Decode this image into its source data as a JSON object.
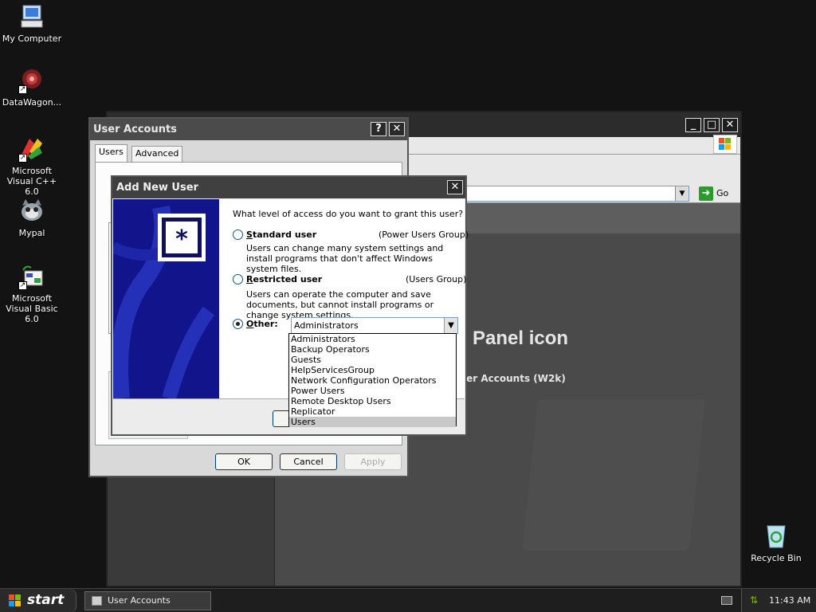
{
  "desktop": {
    "icons": [
      {
        "label": "My Computer",
        "icon": "computer-icon"
      },
      {
        "label": "DataWagon...",
        "icon": "datawagon-icon"
      },
      {
        "label": "Microsoft Visual C++ 6.0",
        "icon": "visual-cpp-icon"
      },
      {
        "label": "Mypal",
        "icon": "mypal-icon"
      },
      {
        "label": "Microsoft Visual Basic 6.0",
        "icon": "visual-basic-icon"
      },
      {
        "label": "Recycle Bin",
        "icon": "recycle-bin-icon"
      }
    ]
  },
  "background_window": {
    "address_go": "Go",
    "heading": "Panel icon",
    "subtext": "ser Accounts (W2k)"
  },
  "user_accounts": {
    "title": "User Accounts",
    "tabs": [
      {
        "label": "Users"
      },
      {
        "label": "Advanced"
      }
    ],
    "ok_label": "OK",
    "cancel_label": "Cancel",
    "apply_label": "Apply"
  },
  "add_new_user": {
    "title": "Add New User",
    "question": "What level of access do you want to grant this user?",
    "standard": {
      "label_hot": "S",
      "label_rest": "tandard user",
      "group": "(Power Users Group)",
      "desc": "Users can change many system settings and install programs that don't affect Windows system files."
    },
    "restricted": {
      "label_hot": "R",
      "label_rest": "estricted user",
      "group": "(Users Group)",
      "desc": "Users can operate the computer and save documents, but cannot install programs or change system settings."
    },
    "other": {
      "label_hot": "O",
      "label_rest": "ther:",
      "selected_value": "Administrators",
      "options": [
        "Administrators",
        "Backup Operators",
        "Guests",
        "HelpServicesGroup",
        "Network Configuration Operators",
        "Power Users",
        "Remote Desktop Users",
        "Replicator",
        "Users"
      ],
      "highlighted_index": 8
    }
  },
  "taskbar": {
    "start_label": "start",
    "tasks": [
      {
        "label": "User Accounts"
      }
    ],
    "clock": "11:43 AM"
  },
  "colors": {
    "desktop_bg": "#131313",
    "banner_blue": "#11148a"
  }
}
